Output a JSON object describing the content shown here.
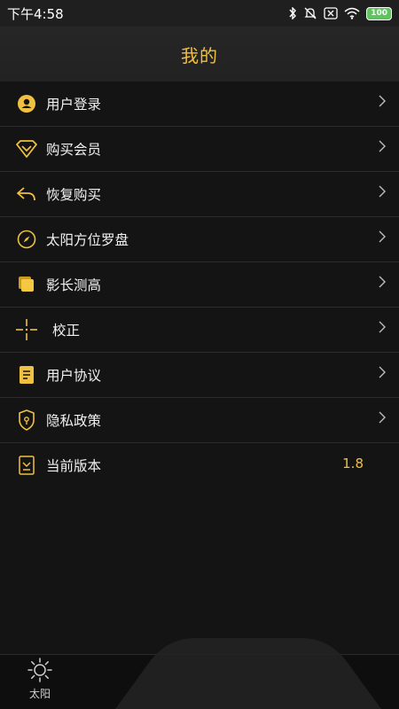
{
  "status_bar": {
    "time": "下午4:58",
    "battery": "100",
    "icons": [
      "bluetooth-icon",
      "mute-icon",
      "sim-icon",
      "wifi-icon",
      "battery-icon"
    ]
  },
  "header": {
    "title": "我的"
  },
  "accent_color": "#f0c040",
  "menu": {
    "items": [
      {
        "label": "用户登录",
        "icon": "user-avatar-icon"
      },
      {
        "label": "购买会员",
        "icon": "diamond-icon"
      },
      {
        "label": "恢复购买",
        "icon": "undo-arrow-icon"
      },
      {
        "label": "太阳方位罗盘",
        "icon": "compass-icon"
      },
      {
        "label": "影长测高",
        "icon": "square-icon"
      },
      {
        "label": "校正",
        "icon": "crosshair-icon"
      },
      {
        "label": "用户协议",
        "icon": "document-icon"
      },
      {
        "label": "隐私政策",
        "icon": "shield-icon"
      },
      {
        "label": "当前版本",
        "icon": "version-icon",
        "value": "1.8"
      }
    ]
  },
  "tabbar": {
    "tabs": [
      {
        "label": "太阳",
        "icon": "sun-icon"
      }
    ]
  }
}
